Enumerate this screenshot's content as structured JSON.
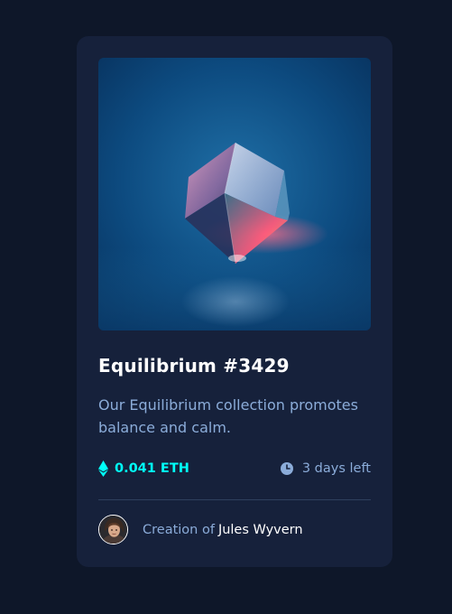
{
  "card": {
    "title": "Equilibrium #3429",
    "description": "Our Equilibrium collection promotes balance and calm.",
    "price": "0.041 ETH",
    "time_left": "3 days left",
    "creator_prefix": "Creation of",
    "creator_name": "Jules Wyvern"
  },
  "icons": {
    "price": "ethereum-icon",
    "time": "clock-icon",
    "creator": "avatar"
  },
  "colors": {
    "background": "#0e1729",
    "card": "#16213b",
    "accent": "#00fff8",
    "soft_blue": "#8bacd9",
    "white": "#ffffff",
    "divider": "#2e405e"
  }
}
